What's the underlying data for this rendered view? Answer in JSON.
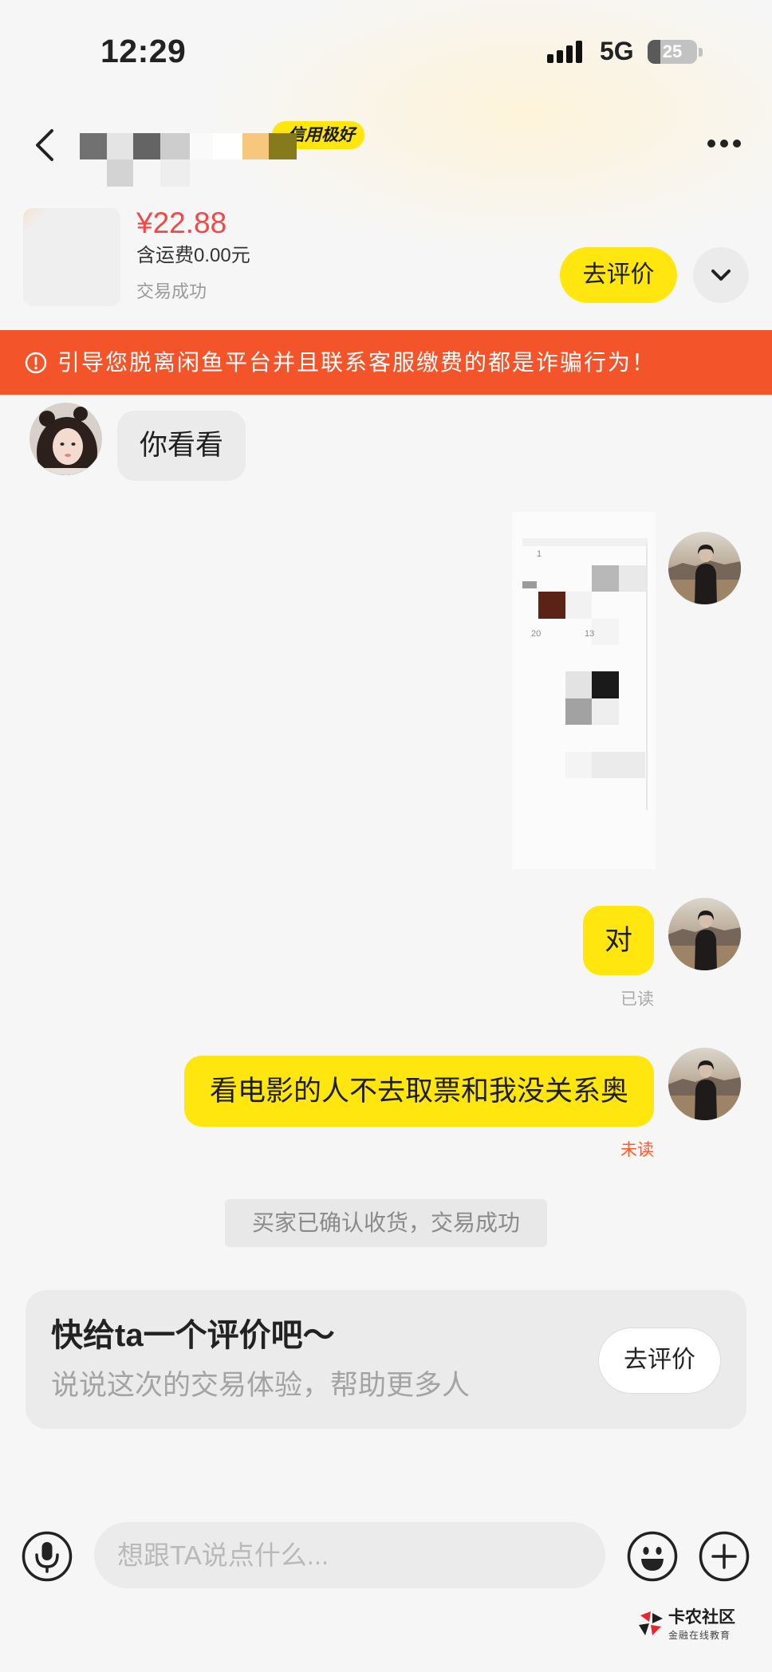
{
  "status_bar": {
    "time": "12:29",
    "network": "5G",
    "battery": "25",
    "battery_level": 0.25
  },
  "header": {
    "credit_badge": "信用极好"
  },
  "product": {
    "price": "¥22.88",
    "shipping": "含运费0.00元",
    "status": "交易成功",
    "review_button": "去评价"
  },
  "warning": {
    "text": "引导您脱离闲鱼平台并且联系客服缴费的都是诈骗行为！"
  },
  "messages": [
    {
      "sender": "other",
      "type": "text",
      "text": "你看看"
    },
    {
      "sender": "self",
      "type": "image",
      "labels": [
        "1",
        "20",
        "13"
      ]
    },
    {
      "sender": "self",
      "type": "text",
      "text": "对",
      "receipt": "已读"
    },
    {
      "sender": "self",
      "type": "text",
      "text": "看电影的人不去取票和我没关系奥",
      "receipt": "未读"
    }
  ],
  "system_notice": "买家已确认收货，交易成功",
  "review_card": {
    "title": "快给ta一个评价吧～",
    "subtitle": "说说这次的交易体验，帮助更多人",
    "button": "去评价"
  },
  "input_bar": {
    "placeholder": "想跟TA说点什么..."
  },
  "watermark": {
    "name": "卡农社区",
    "tagline": "金融在线教育"
  },
  "icons": {
    "back": "chevron-left-icon",
    "more": "more-dots-icon",
    "expand": "chevron-down-icon",
    "warning": "alert-circle-icon",
    "voice": "microphone-icon",
    "emoji": "smiley-icon",
    "add": "plus-circle-icon",
    "signal": "cellular-signal-icon",
    "battery": "battery-icon"
  },
  "colors": {
    "brand_yellow": "#ffe60f",
    "price_red": "#f24848",
    "warning_bg": "#f4542a",
    "unread_red": "#ff5a2c",
    "read_gray": "#aaaaaa"
  }
}
